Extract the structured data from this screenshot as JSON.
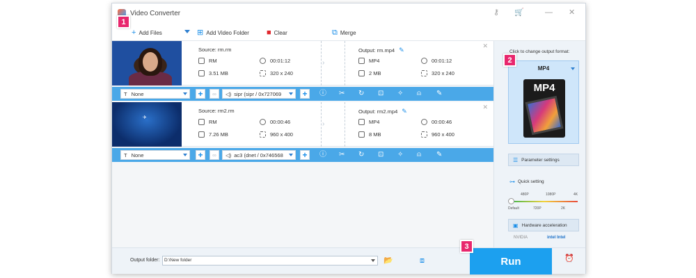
{
  "window": {
    "title": "Video Converter"
  },
  "title_controls": {
    "key_icon": "key-icon",
    "cart_icon": "cart-icon",
    "minimize": "—",
    "close": "✕"
  },
  "toolbar": {
    "add_files": "Add Files",
    "add_video_folder": "Add Video Folder",
    "clear": "Clear",
    "merge": "Merge"
  },
  "steps": {
    "step1": "1",
    "step2": "2",
    "step3": "3"
  },
  "files": [
    {
      "source": "Source: rm.rm",
      "src_format": "RM",
      "src_duration": "00:01:12",
      "src_size": "3.51 MB",
      "src_res": "320 x 240",
      "output": "Output: rm.mp4",
      "out_format": "MP4",
      "out_duration": "00:01:12",
      "out_size": "2 MB",
      "out_res": "320 x 240",
      "subtitle": "None",
      "audio": "sipr (sipr / 0x727069"
    },
    {
      "source": "Source: rm2.rm",
      "src_format": "RM",
      "src_duration": "00:00:46",
      "src_size": "7.26 MB",
      "src_res": "960 x 400",
      "output": "Output: rm2.mp4",
      "out_format": "MP4",
      "out_duration": "00:00:46",
      "out_size": "8 MB",
      "out_res": "960 x 400",
      "subtitle": "None",
      "audio": "ac3 (dnet / 0x746568"
    }
  ],
  "sidepanel": {
    "hint": "Click to change output format:",
    "format": "MP4",
    "format_icon_text": "MP4",
    "parameter_settings": "Parameter settings",
    "quick_setting": "Quick setting",
    "ticks_top": [
      "480P",
      "1080P",
      "4K"
    ],
    "ticks_bottom": [
      "Default",
      "720P",
      "2K"
    ],
    "hardware_acceleration": "Hardware acceleration",
    "nvidia": "NVIDIA",
    "intel": "intel  Intel"
  },
  "bottom": {
    "output_folder_label": "Output folder:",
    "output_folder_value": "D:\\New folder",
    "run": "Run"
  }
}
